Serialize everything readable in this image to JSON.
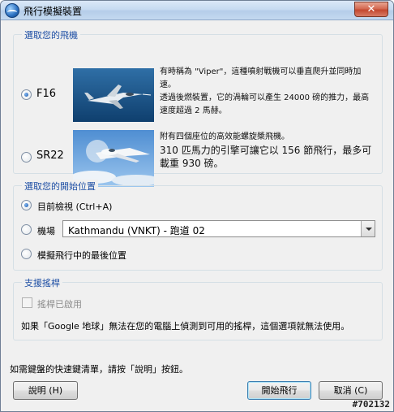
{
  "window": {
    "title": "飛行模擬裝置",
    "close_glyph": "✕"
  },
  "aircraft": {
    "legend": "選取您的飛機",
    "options": [
      {
        "label": "F16",
        "selected": true,
        "desc": [
          "有時稱為 \"Viper\"，這種噴射戰機可以垂直爬升並同時加速。",
          "透過後燃裝置，它的渦輪可以產生 24000 磅的推力，最高速度超過 2 馬赫。"
        ]
      },
      {
        "label": "SR22",
        "selected": false,
        "desc": [
          "附有四個座位的高效能螺旋槳飛機。",
          "310 匹馬力的引擎可讓它以 156 節飛行，最多可載重 930 磅。"
        ]
      }
    ]
  },
  "start": {
    "legend": "選取您的開始位置",
    "current_view": "目前檢視 (Ctrl+A)",
    "airport_label": "機場",
    "airport_value": "Kathmandu (VNKT) - 跑道 02",
    "last_position": "模擬飛行中的最後位置"
  },
  "joystick": {
    "legend": "支援搖桿",
    "enabled_label": "搖桿已啟用",
    "note": "如果「Google 地球」無法在您的電腦上偵測到可用的搖桿，這個選項就無法使用。"
  },
  "footer": {
    "hint": "如需鍵盤的快速鍵清單，請按「說明」按鈕。",
    "help_button": "說明 (H)",
    "start_button": "開始飛行",
    "cancel_button": "取消 (C)",
    "watermark": "#702132"
  }
}
